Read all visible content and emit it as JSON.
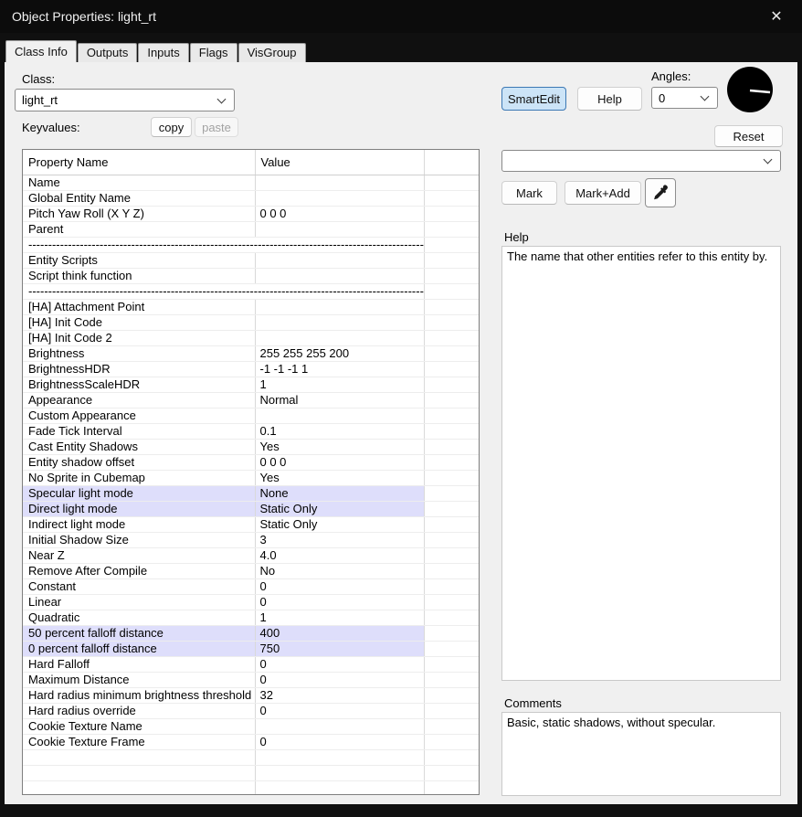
{
  "window": {
    "title": "Object Properties: light_rt",
    "close_glyph": "✕"
  },
  "tabs": [
    {
      "label": "Class Info",
      "active": true
    },
    {
      "label": "Outputs",
      "active": false
    },
    {
      "label": "Inputs",
      "active": false
    },
    {
      "label": "Flags",
      "active": false
    },
    {
      "label": "VisGroup",
      "active": false
    }
  ],
  "class_section": {
    "label": "Class:",
    "selected_class": "light_rt",
    "keyvalues_label": "Keyvalues:",
    "copy_button": "copy",
    "paste_button": "paste"
  },
  "controls": {
    "smartedit_button": "SmartEdit",
    "help_button": "Help",
    "angles_label": "Angles:",
    "angles_value": "0",
    "reset_button": "Reset",
    "value_combo_value": "",
    "mark_button": "Mark",
    "mark_add_button": "Mark+Add",
    "eyedropper_icon": "eyedropper-icon",
    "angle_dial_icon": "angle-dial"
  },
  "property_table": {
    "headers": [
      "Property Name",
      "Value"
    ],
    "rows": [
      {
        "name": "Name",
        "value": ""
      },
      {
        "name": "Global Entity Name",
        "value": ""
      },
      {
        "name": "Pitch Yaw Roll (X Y Z)",
        "value": "0 0 0"
      },
      {
        "name": "Parent",
        "value": ""
      },
      {
        "separator": true,
        "name": "------------------------------------------------------------------------------------------------------------------------",
        "value": ""
      },
      {
        "name": "Entity Scripts",
        "value": ""
      },
      {
        "name": "Script think function",
        "value": ""
      },
      {
        "separator": true,
        "name": "------------------------------------------------------------------------------------------------------------------------",
        "value": ""
      },
      {
        "name": "[HA] Attachment Point",
        "value": ""
      },
      {
        "name": "[HA] Init Code",
        "value": ""
      },
      {
        "name": "[HA] Init Code 2",
        "value": ""
      },
      {
        "name": "Brightness",
        "value": "255 255 255 200"
      },
      {
        "name": "BrightnessHDR",
        "value": "-1 -1 -1 1"
      },
      {
        "name": "BrightnessScaleHDR",
        "value": "1"
      },
      {
        "name": "Appearance",
        "value": "Normal"
      },
      {
        "name": "Custom Appearance",
        "value": ""
      },
      {
        "name": "Fade Tick Interval",
        "value": "0.1"
      },
      {
        "name": "Cast Entity Shadows",
        "value": "Yes"
      },
      {
        "name": "Entity shadow offset",
        "value": "0 0 0"
      },
      {
        "name": "No Sprite in Cubemap",
        "value": "Yes"
      },
      {
        "name": "Specular light mode",
        "value": "None",
        "highlight": true
      },
      {
        "name": "Direct light mode",
        "value": "Static Only",
        "highlight": true
      },
      {
        "name": "Indirect light mode",
        "value": "Static Only"
      },
      {
        "name": "Initial Shadow Size",
        "value": "3"
      },
      {
        "name": "Near Z",
        "value": "4.0"
      },
      {
        "name": "Remove After Compile",
        "value": "No"
      },
      {
        "name": "Constant",
        "value": "0"
      },
      {
        "name": "Linear",
        "value": "0"
      },
      {
        "name": "Quadratic",
        "value": "1"
      },
      {
        "name": "50 percent falloff distance",
        "value": "400",
        "highlight": true
      },
      {
        "name": "0 percent falloff distance",
        "value": "750",
        "highlight": true
      },
      {
        "name": "Hard Falloff",
        "value": "0"
      },
      {
        "name": "Maximum Distance",
        "value": "0"
      },
      {
        "name": "Hard radius minimum brightness threshold",
        "value": "32"
      },
      {
        "name": "Hard radius override",
        "value": "0"
      },
      {
        "name": "Cookie Texture Name",
        "value": ""
      },
      {
        "name": "Cookie Texture Frame",
        "value": "0"
      },
      {
        "name": "",
        "value": ""
      },
      {
        "name": "",
        "value": ""
      },
      {
        "name": "",
        "value": ""
      }
    ]
  },
  "help_panel": {
    "label": "Help",
    "text": "The name that other entities refer to this entity by."
  },
  "comments_panel": {
    "label": "Comments",
    "text": "Basic, static shadows, without specular."
  },
  "colors": {
    "highlight_row": "#dedefb",
    "smartedit_fill": "#cce4f7",
    "smartedit_border": "#3c78b4"
  }
}
